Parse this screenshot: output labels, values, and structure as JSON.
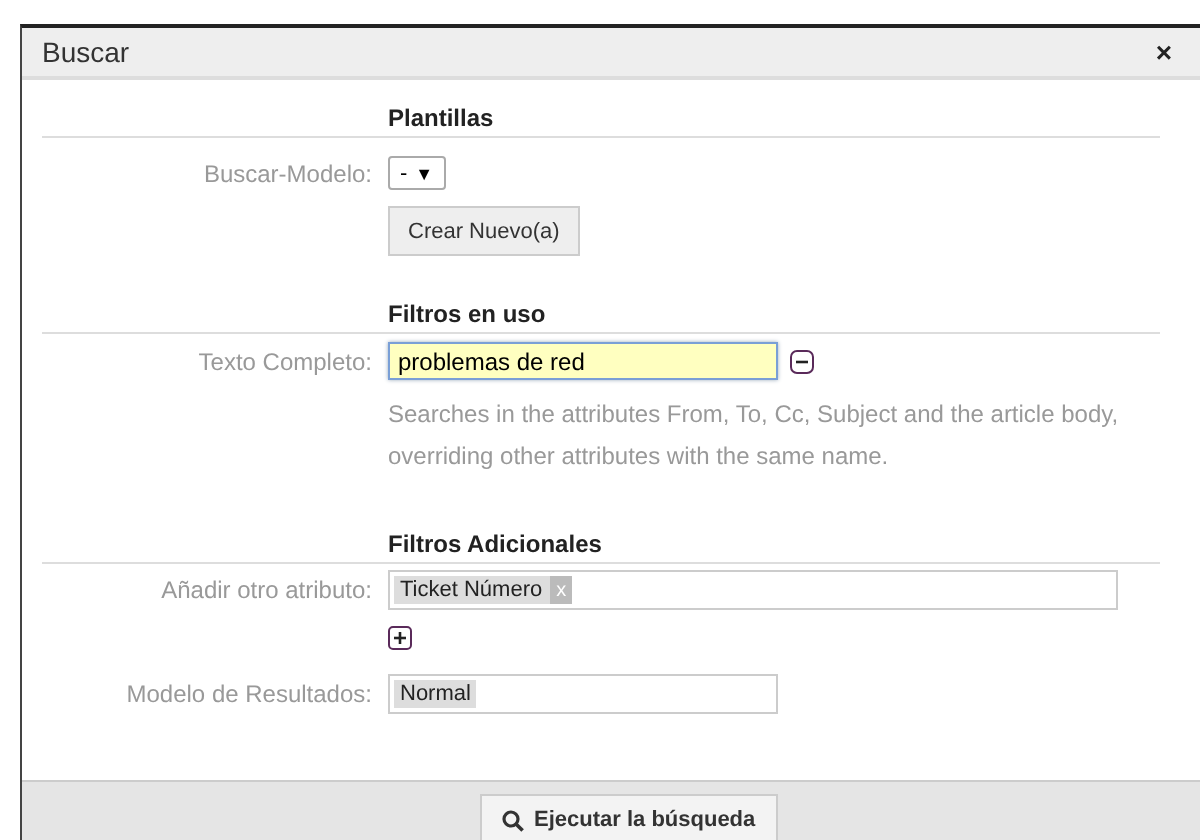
{
  "dialog": {
    "title": "Buscar",
    "close": "×"
  },
  "sections": [
    {
      "heading": "Plantillas",
      "rows": [
        {
          "kind": "select",
          "label": "Buscar-Modelo:",
          "value": "-",
          "caret": "▼"
        },
        {
          "kind": "button",
          "label": "Crear Nuevo(a)"
        }
      ]
    },
    {
      "heading": "Filtros en uso",
      "rows": [
        {
          "kind": "text",
          "label": "Texto Completo:",
          "value": "problemas de red",
          "focused": true,
          "removable": true
        },
        {
          "kind": "help",
          "text": "Searches in the attributes From, To, Cc, Subject and the article body, overriding other attributes with the same name."
        }
      ]
    },
    {
      "heading": "Filtros Adicionales",
      "rows": [
        {
          "kind": "tags",
          "label": "Añadir otro atributo:",
          "wide": true,
          "tags": [
            {
              "label": "Ticket Número",
              "remove": "x"
            }
          ]
        },
        {
          "kind": "add"
        },
        {
          "kind": "tags",
          "label": "Modelo de Resultados:",
          "wide": false,
          "tags": [
            {
              "label": "Normal"
            }
          ]
        }
      ]
    }
  ],
  "footer": {
    "button": "Ejecutar la búsqueda"
  }
}
